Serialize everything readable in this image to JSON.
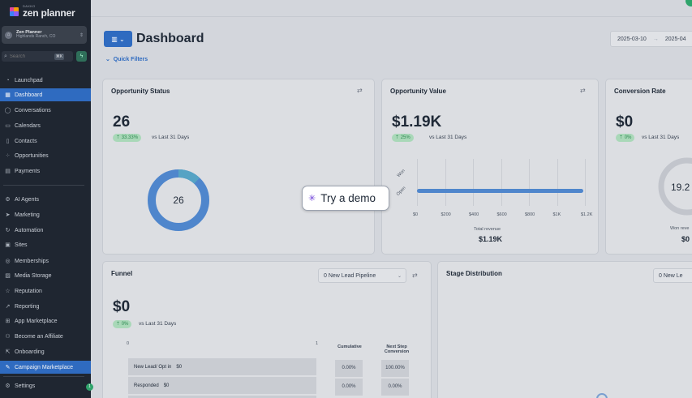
{
  "sidebar": {
    "logo_small": "DAXKO",
    "logo_main": "zen planner",
    "location_name": "Zen Planner",
    "location_sub": "Highlands Ranch, CO",
    "search_placeholder": "Search",
    "search_shortcut": "⌘K",
    "nav_top": [
      {
        "label": "Launchpad",
        "icon": "rocket-icon"
      },
      {
        "label": "Dashboard",
        "icon": "dashboard-icon",
        "active": true
      },
      {
        "label": "Conversations",
        "icon": "chat-icon"
      },
      {
        "label": "Calendars",
        "icon": "calendar-icon"
      },
      {
        "label": "Contacts",
        "icon": "contacts-icon"
      },
      {
        "label": "Opportunities",
        "icon": "opportunities-icon"
      },
      {
        "label": "Payments",
        "icon": "payments-icon"
      }
    ],
    "nav_bottom": [
      {
        "label": "AI Agents",
        "icon": "ai-icon"
      },
      {
        "label": "Marketing",
        "icon": "send-icon"
      },
      {
        "label": "Automation",
        "icon": "automation-icon"
      },
      {
        "label": "Sites",
        "icon": "sites-icon"
      },
      {
        "label": "Memberships",
        "icon": "memberships-icon"
      },
      {
        "label": "Media Storage",
        "icon": "media-icon"
      },
      {
        "label": "Reputation",
        "icon": "star-icon"
      },
      {
        "label": "Reporting",
        "icon": "chart-icon"
      },
      {
        "label": "App Marketplace",
        "icon": "apps-icon"
      },
      {
        "label": "Become an Affiliate",
        "icon": "affiliate-icon"
      },
      {
        "label": "Onboarding",
        "icon": "onboarding-icon"
      },
      {
        "label": "Campaign Marketplace",
        "icon": "campaign-icon",
        "active": true
      }
    ],
    "settings_label": "Settings",
    "settings_badge": "1"
  },
  "header": {
    "title": "Dashboard",
    "quick_filters": "Quick Filters",
    "date_start": "2025-03-10",
    "date_end": "2025-04"
  },
  "opportunity_status": {
    "title": "Opportunity Status",
    "value": "26",
    "change": "33.33%",
    "vs": "vs Last 31 Days",
    "donut_label": "26",
    "donut_fraction_secondary": 0.12
  },
  "opportunity_value": {
    "title": "Opportunity Value",
    "value": "$1.19K",
    "change": "25%",
    "vs": "vs Last 31 Days",
    "y_labels": [
      "Won",
      "Open"
    ],
    "x_ticks": [
      "$0",
      "$200",
      "$400",
      "$600",
      "$800",
      "$1K",
      "$1.2K"
    ],
    "bar_open_value": 1190,
    "bar_max": 1200,
    "total_label": "Total revenue",
    "total_value": "$1.19K"
  },
  "conversion_rate": {
    "title": "Conversion Rate",
    "value": "$0",
    "change": "0%",
    "vs": "vs Last 31 Days",
    "donut_label": "19.2",
    "won_label": "Won reve",
    "won_value": "$0"
  },
  "funnel": {
    "title": "Funnel",
    "pipeline": "0 New Lead Pipeline",
    "value": "$0",
    "change": "0%",
    "vs": "vs Last 31 Days",
    "axis_start": "0",
    "axis_end": "1",
    "col_cumulative": "Cumulative",
    "col_next_step": "Next Step Conversion",
    "rows": [
      {
        "stage": "New Lead/ Opt in",
        "value": "$0",
        "cumulative": "0.00%",
        "next": "100.00%"
      },
      {
        "stage": "Responded",
        "value": "$0",
        "cumulative": "0.00%",
        "next": "0.00%"
      }
    ]
  },
  "stage_distribution": {
    "title": "Stage Distribution",
    "pipeline": "0 New Le"
  },
  "demo": {
    "label": "Try a demo"
  }
}
